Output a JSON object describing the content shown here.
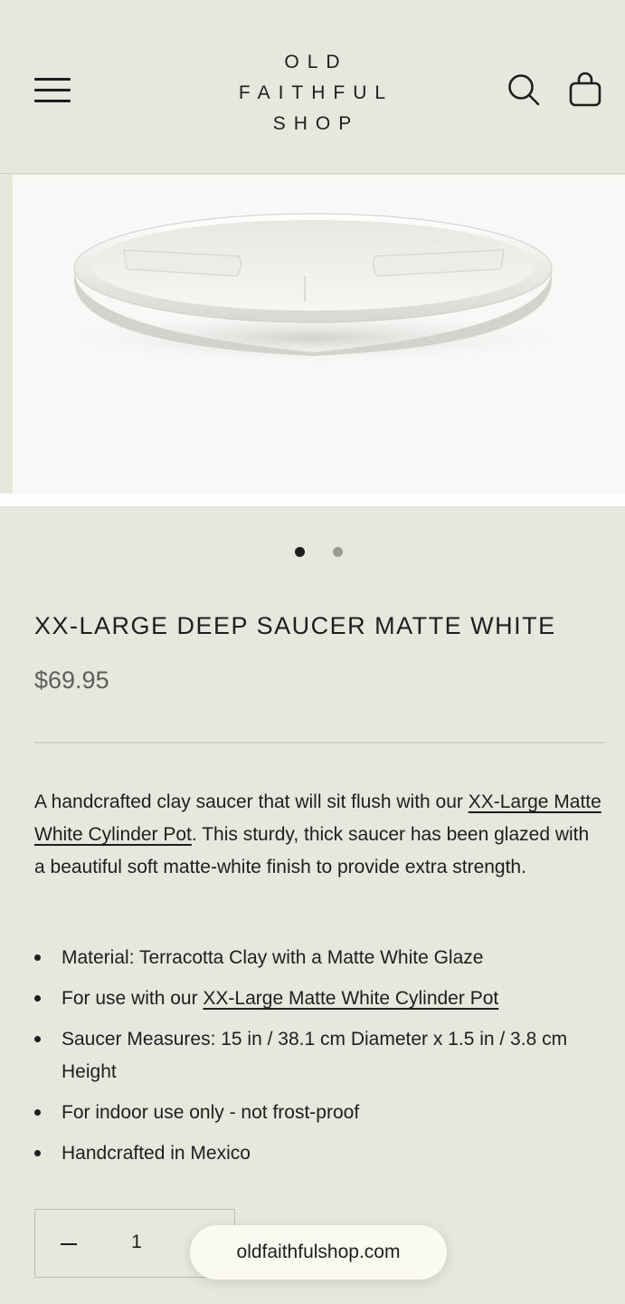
{
  "header": {
    "logo_line1": "OLD",
    "logo_line2": "FAITHFUL",
    "logo_line3": "SHOP"
  },
  "icons": {
    "menu": "hamburger-menu-icon",
    "search": "search-icon",
    "cart": "shopping-bag-icon"
  },
  "gallery": {
    "image_description": "matte white clay saucer",
    "slides": 2,
    "active_slide": 1
  },
  "product": {
    "title": "XX-LARGE DEEP SAUCER MATTE WHITE",
    "price": "$69.95",
    "description_part1": "A handcrafted clay saucer that will sit flush with our ",
    "description_link": "XX-Large Matte White Cylinder Pot",
    "description_part2": ". This sturdy, thick saucer has been glazed with a beautiful soft matte-white finish to provide extra strength.",
    "features": {
      "item1": "Material: Terracotta Clay with a Matte White Glaze",
      "item2_prefix": "For use with our ",
      "item2_link": "XX-Large Matte White Cylinder Pot",
      "item3": "Saucer Measures: 15 in / 38.1 cm Diameter x 1.5 in / 3.8 cm Height",
      "item4": "For indoor use only - not frost-proof",
      "item5": "Handcrafted in Mexico"
    }
  },
  "quantity": {
    "value": "1"
  },
  "browser": {
    "url": "oldfaithfulshop.com"
  },
  "colors": {
    "background": "#e8e7dd",
    "text": "#1e1e1e",
    "price": "#5e5e5b"
  }
}
